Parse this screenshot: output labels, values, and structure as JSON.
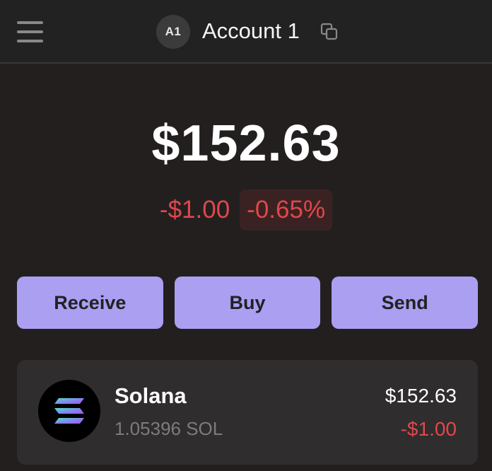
{
  "header": {
    "menu_icon": "hamburger-menu-icon",
    "avatar_initials": "A1",
    "account_name": "Account 1",
    "copy_icon": "copy-icon"
  },
  "balance": {
    "total": "$152.63",
    "change_amount": "-$1.00",
    "change_percent": "-0.65%"
  },
  "actions": {
    "receive_label": "Receive",
    "buy_label": "Buy",
    "send_label": "Send"
  },
  "tokens": [
    {
      "name": "Solana",
      "amount": "1.05396 SOL",
      "value": "$152.63",
      "change": "-$1.00",
      "icon": "solana-logo-icon"
    }
  ],
  "colors": {
    "background": "#231f1f",
    "accent": "#ab9ff2",
    "negative": "#e0474c",
    "card": "#2f2d2d"
  }
}
